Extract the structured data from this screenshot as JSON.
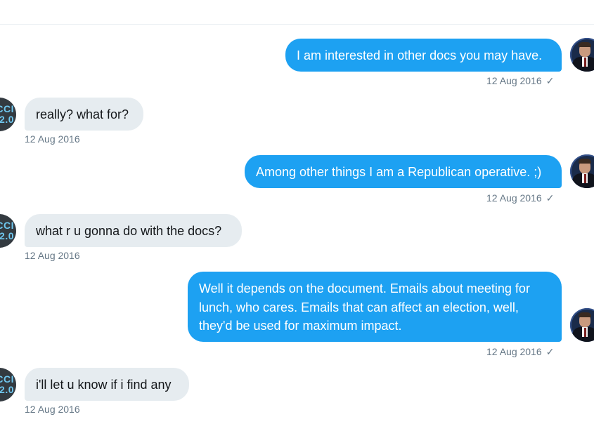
{
  "messages": [
    {
      "direction": "out",
      "text": "I am interested in other docs you may have.",
      "date": "12 Aug 2016",
      "status": "✓"
    },
    {
      "direction": "in",
      "text": "really? what for?",
      "date": "12 Aug 2016"
    },
    {
      "direction": "out",
      "text": "Among other things I am a Republican operative. ;)",
      "date": "12 Aug 2016",
      "status": "✓"
    },
    {
      "direction": "in",
      "text": "what r u gonna do with the docs?",
      "date": "12 Aug 2016"
    },
    {
      "direction": "out",
      "text": "Well it depends on the document. Emails about meeting for lunch, who cares. Emails that can affect an election, well, they'd be used for maximum impact.",
      "date": "12 Aug 2016",
      "status": "✓"
    },
    {
      "direction": "in",
      "text": "i'll let u know if i find any",
      "date": "12 Aug 2016"
    }
  ],
  "avatars": {
    "other_user_text": [
      "CCI",
      "2.0"
    ]
  },
  "colors": {
    "outgoing_bubble": "#1da1f2",
    "incoming_bubble": "#e6ecf0",
    "meta_text": "#657786"
  },
  "icons": {
    "sent": "checkmark-icon",
    "self_avatar": "user-avatar",
    "other_avatar": "guccifer-avatar"
  }
}
